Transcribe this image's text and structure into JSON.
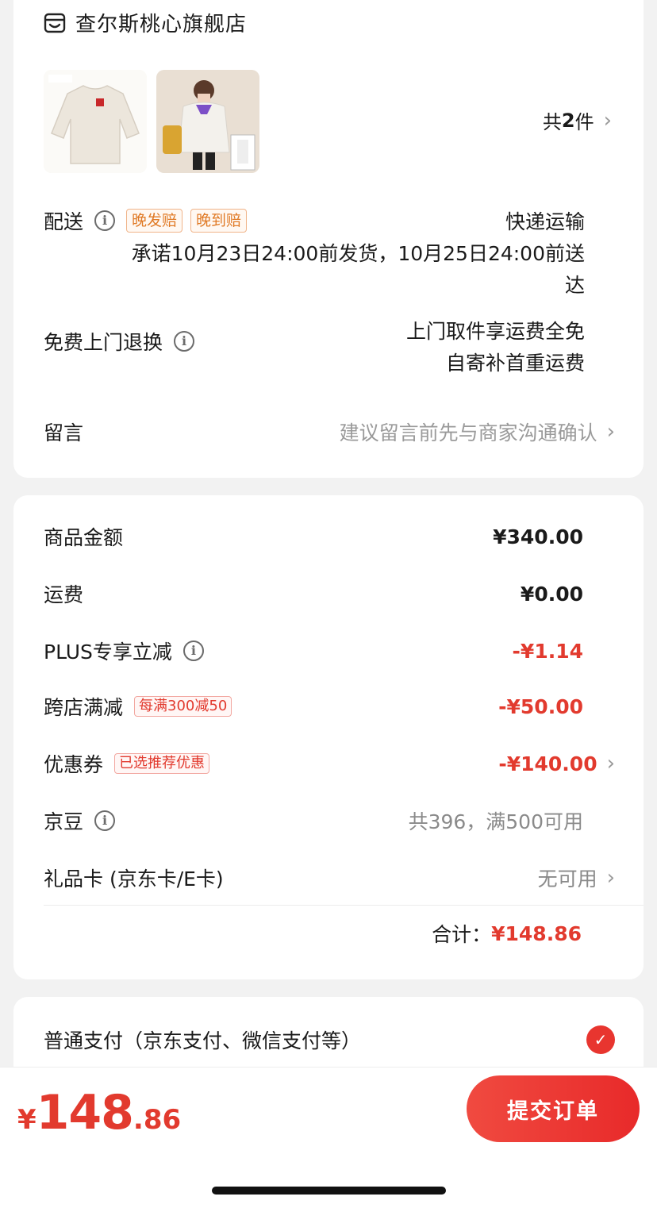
{
  "store": {
    "name": "查尔斯桃心旗舰店"
  },
  "items": {
    "count_prefix": "共",
    "count_num": "2",
    "count_suffix": "件"
  },
  "delivery": {
    "label": "配送",
    "tags": [
      "晚发赔",
      "晚到赔"
    ],
    "method": "快递运输",
    "promise_line1": "承诺10月23日24:00前发货，10月25日24:00前送",
    "promise_line2": "达"
  },
  "returns": {
    "label": "免费上门退换",
    "line1": "上门取件享运费全免",
    "line2": "自寄补首重运费"
  },
  "message": {
    "label": "留言",
    "placeholder": "建议留言前先与商家沟通确认"
  },
  "pricing": {
    "goods_label": "商品金额",
    "goods_value": "¥340.00",
    "shipping_label": "运费",
    "shipping_value": "¥0.00",
    "plus_label": "PLUS专享立减",
    "plus_value": "-¥1.14",
    "cross_label": "跨店满减",
    "cross_tag": "每满300减50",
    "cross_value": "-¥50.00",
    "coupon_label": "优惠券",
    "coupon_tag": "已选推荐优惠",
    "coupon_value": "-¥140.00",
    "beans_label": "京豆",
    "beans_value": "共396，满500可用",
    "gift_label": "礼品卡 (京东卡/E卡)",
    "gift_value": "无可用",
    "total_label": "合计：",
    "total_value": "¥148.86"
  },
  "payment": {
    "label": "普通支付（京东支付、微信支付等）"
  },
  "footer": {
    "currency": "¥",
    "price_int": "148",
    "price_dec": ".86",
    "submit_label": "提交订单"
  },
  "colors": {
    "accent": "#e23a2e",
    "tag_orange": "#e07a26"
  }
}
